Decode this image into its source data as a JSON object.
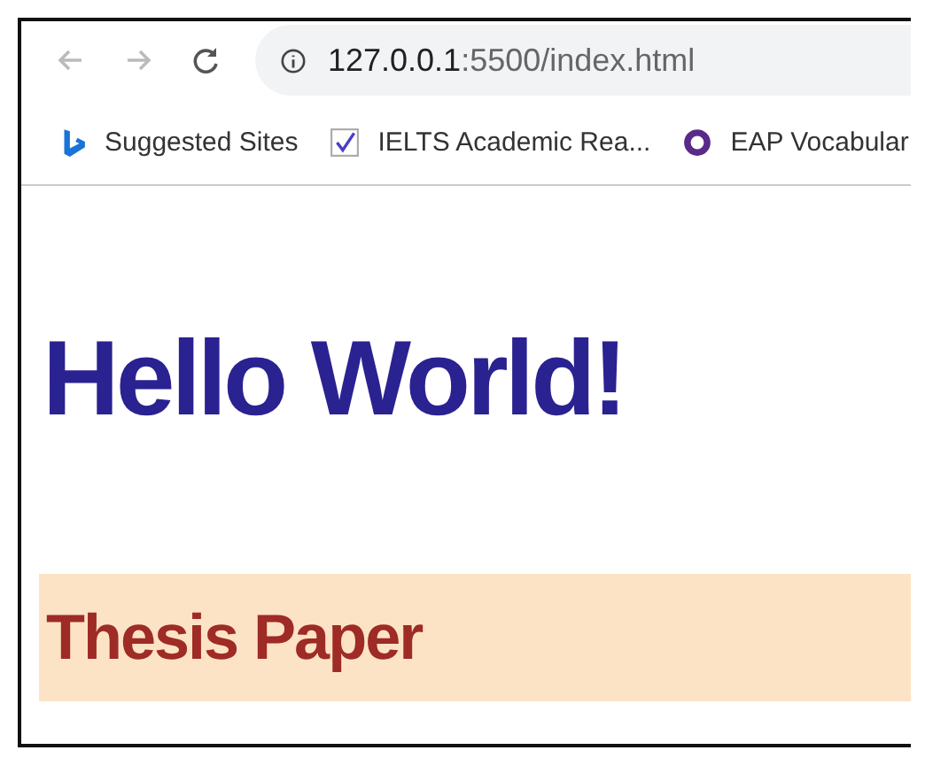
{
  "toolbar": {
    "url_host": "127.0.0.1",
    "url_path": ":5500/index.html"
  },
  "bookmarks": [
    {
      "kind": "bing",
      "label": "Suggested Sites"
    },
    {
      "kind": "check",
      "label": "IELTS Academic Rea..."
    },
    {
      "kind": "eap",
      "label": "EAP Vocabular"
    }
  ],
  "page": {
    "heading": "Hello World!",
    "subheading": "Thesis Paper"
  }
}
